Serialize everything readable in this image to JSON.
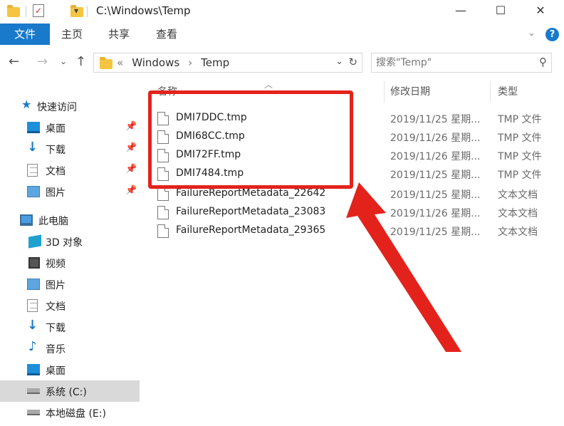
{
  "titlebar": {
    "title": "C:\\Windows\\Temp",
    "minimize": "—",
    "maximize": "☐",
    "close": "✕"
  },
  "ribbon": {
    "tabs": [
      "文件",
      "主页",
      "共享",
      "查看"
    ]
  },
  "address": {
    "prefix": "«",
    "segments": [
      "Windows",
      "›",
      "Temp"
    ]
  },
  "search": {
    "placeholder": "搜索\"Temp\""
  },
  "sidebar": {
    "items": [
      {
        "label": "快速访问"
      },
      {
        "label": "桌面"
      },
      {
        "label": "下载"
      },
      {
        "label": "文档"
      },
      {
        "label": "图片"
      },
      {
        "label": "此电脑"
      },
      {
        "label": "3D 对象"
      },
      {
        "label": "视频"
      },
      {
        "label": "图片"
      },
      {
        "label": "文档"
      },
      {
        "label": "下载"
      },
      {
        "label": "音乐"
      },
      {
        "label": "桌面"
      },
      {
        "label": "系统 (C:)"
      },
      {
        "label": "本地磁盘 (E:)"
      }
    ]
  },
  "columns": {
    "name": "名称",
    "date": "修改日期",
    "type": "类型"
  },
  "files": [
    {
      "name": "DMI7DDC.tmp",
      "date": "2019/11/25 星期...",
      "type": "TMP 文件"
    },
    {
      "name": "DMI68CC.tmp",
      "date": "2019/11/26 星期...",
      "type": "TMP 文件"
    },
    {
      "name": "DMI72FF.tmp",
      "date": "2019/11/26 星期...",
      "type": "TMP 文件"
    },
    {
      "name": "DMI7484.tmp",
      "date": "2019/11/25 星期...",
      "type": "TMP 文件"
    },
    {
      "name": "FailureReportMetadata_22642",
      "date": "2019/11/25 星期...",
      "type": "文本文档"
    },
    {
      "name": "FailureReportMetadata_23083",
      "date": "2019/11/26 星期...",
      "type": "文本文档"
    },
    {
      "name": "FailureReportMetadata_29365",
      "date": "2019/11/25 星期...",
      "type": "文本文档"
    }
  ],
  "colors": {
    "accent": "#1979ca",
    "annotation": "#e4221c"
  }
}
